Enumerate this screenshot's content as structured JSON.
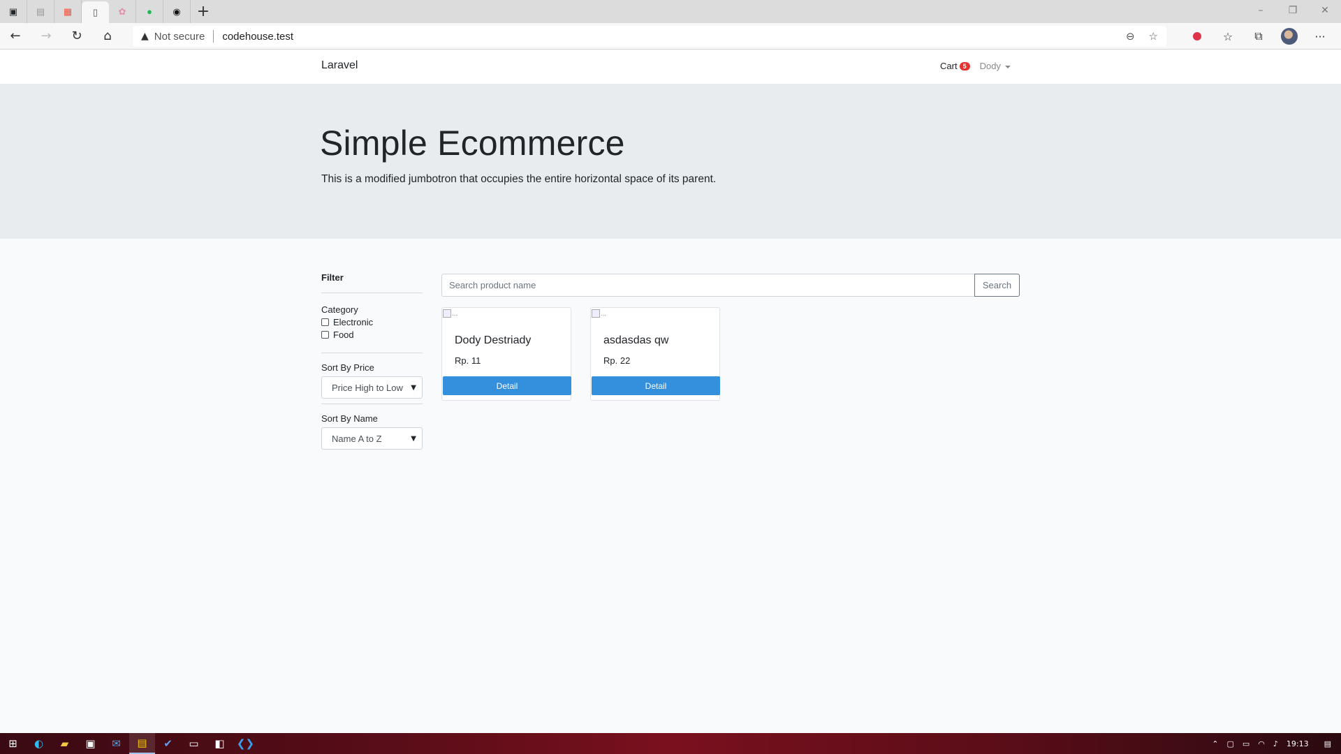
{
  "browser": {
    "tabs": [
      {
        "icon": "tab-actions-icon"
      },
      {
        "icon": "page-icon"
      },
      {
        "icon": "laravel-icon"
      },
      {
        "icon": "document-icon"
      },
      {
        "icon": "flower-icon"
      },
      {
        "icon": "badge-icon"
      },
      {
        "icon": "github-icon"
      }
    ],
    "address": {
      "security_label": "Not secure",
      "url": "codehouse.test"
    }
  },
  "navbar": {
    "brand": "Laravel",
    "cart_label": "Cart",
    "cart_count": "5",
    "user_name": "Dody"
  },
  "jumbotron": {
    "title": "Simple Ecommerce",
    "lead": "This is a modified jumbotron that occupies the entire horizontal space of its parent."
  },
  "filter": {
    "title": "Filter",
    "category_label": "Category",
    "categories": [
      {
        "label": "Electronic",
        "checked": false
      },
      {
        "label": "Food",
        "checked": false
      }
    ],
    "sort_price_label": "Sort By Price",
    "sort_price_value": "Price High to Low",
    "sort_name_label": "Sort By Name",
    "sort_name_value": "Name A to Z"
  },
  "search": {
    "placeholder": "Search product name",
    "button_label": "Search"
  },
  "products": [
    {
      "image_alt": "...",
      "name": "Dody Destriady",
      "price": "Rp. 11",
      "button": "Detail"
    },
    {
      "image_alt": "...",
      "name": "asdasdas qw",
      "price": "Rp. 22",
      "button": "Detail"
    }
  ],
  "taskbar": {
    "clock": "19:13"
  },
  "colors": {
    "primary": "#3490dc",
    "danger": "#e3342f",
    "jumbotron_bg": "#e9ecef",
    "page_bg": "#f8fafc"
  }
}
